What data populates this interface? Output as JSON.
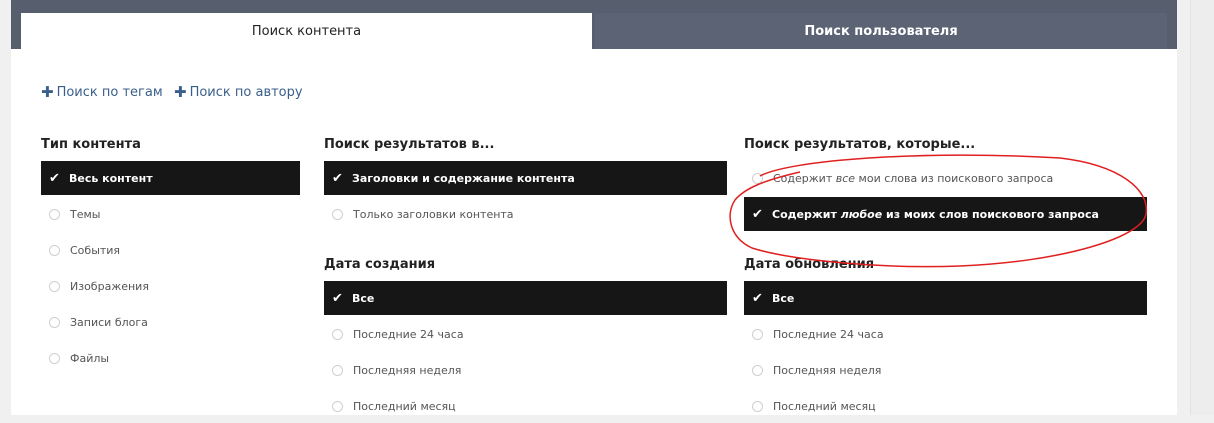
{
  "tabs": [
    {
      "label": "Поиск контента"
    },
    {
      "label": "Поиск пользователя"
    }
  ],
  "links": [
    {
      "label": "Поиск по тегам"
    },
    {
      "label": "Поиск по автору"
    }
  ],
  "content_type": {
    "heading": "Тип контента",
    "options": [
      {
        "label": "Весь контент"
      },
      {
        "label": "Темы"
      },
      {
        "label": "События"
      },
      {
        "label": "Изображения"
      },
      {
        "label": "Записи блога"
      },
      {
        "label": "Файлы"
      }
    ]
  },
  "search_in": {
    "heading": "Поиск результатов в...",
    "options": [
      {
        "label": "Заголовки и содержание контента"
      },
      {
        "label": "Только заголовки контента"
      }
    ]
  },
  "match": {
    "heading": "Поиск результатов, которые...",
    "options": [
      {
        "pre": "Содержит ",
        "em": "все",
        "post": " мои слова из поискового запроса"
      },
      {
        "pre": "Содержит ",
        "em": "любое",
        "post": " из моих слов поискового запроса"
      }
    ]
  },
  "date_created": {
    "heading": "Дата создания",
    "options": [
      {
        "label": "Все"
      },
      {
        "label": "Последние 24 часа"
      },
      {
        "label": "Последняя неделя"
      },
      {
        "label": "Последний месяц"
      }
    ]
  },
  "date_updated": {
    "heading": "Дата обновления",
    "options": [
      {
        "label": "Все"
      },
      {
        "label": "Последние 24 часа"
      },
      {
        "label": "Последняя неделя"
      },
      {
        "label": "Последний месяц"
      }
    ]
  },
  "colors": {
    "annotation": "#e02020",
    "tabbar": "#575f6f",
    "selected": "#161616",
    "link": "#3a5f8a"
  },
  "icons": {
    "check": "check-icon",
    "plus": "plus-icon",
    "radio": "radio-icon"
  }
}
